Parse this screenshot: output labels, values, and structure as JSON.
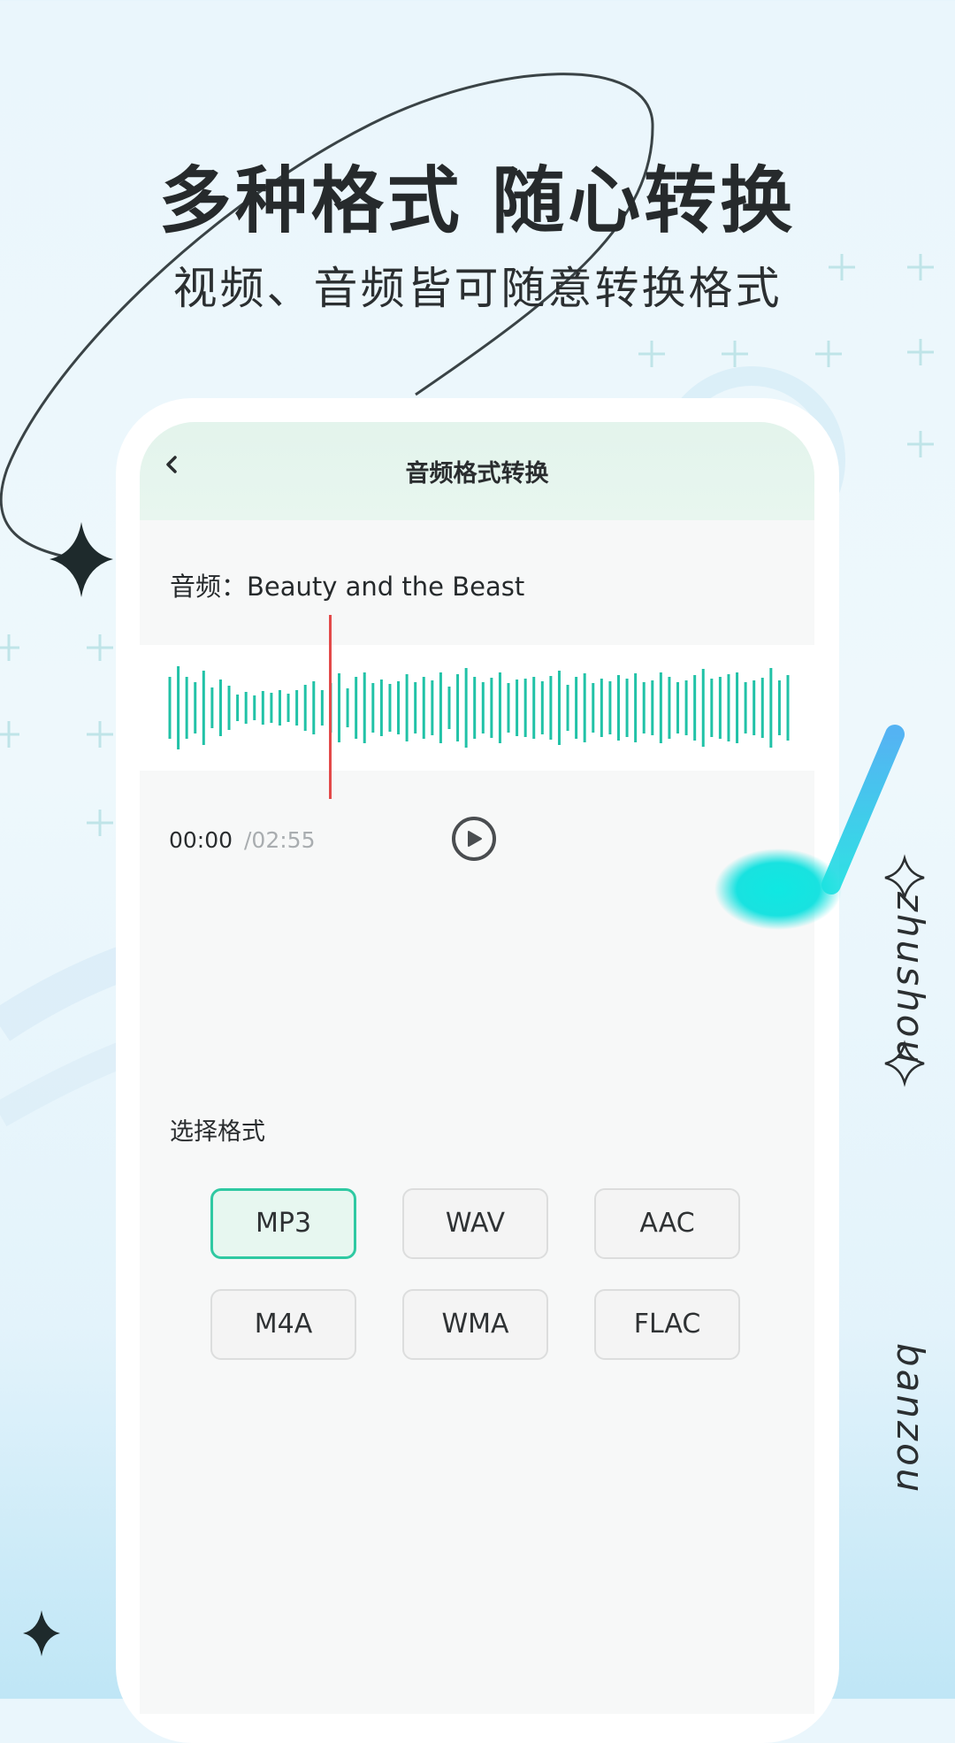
{
  "promo": {
    "headline": "多种格式  随心转换",
    "subheadline": "视频、音频皆可随意转换格式",
    "side_text_1": "zhushou",
    "side_text_2": "banzou"
  },
  "app": {
    "title": "音频格式转换",
    "back_icon": "chevron-left-icon",
    "audio_label": "音频：Beauty and the Beast",
    "time_current": "00:00",
    "time_total": "/02:55",
    "play_icon": "play-icon",
    "select_format_label": "选择格式",
    "formats": [
      "MP3",
      "WAV",
      "AAC",
      "M4A",
      "WMA",
      "FLAC"
    ],
    "selected_format": "MP3"
  },
  "colors": {
    "accent": "#2fc9a2",
    "waveform": "#21c2a7",
    "playhead": "#e34a4a",
    "header_bg": "#e3f4ec",
    "screen_bg": "#f7f8f8"
  }
}
